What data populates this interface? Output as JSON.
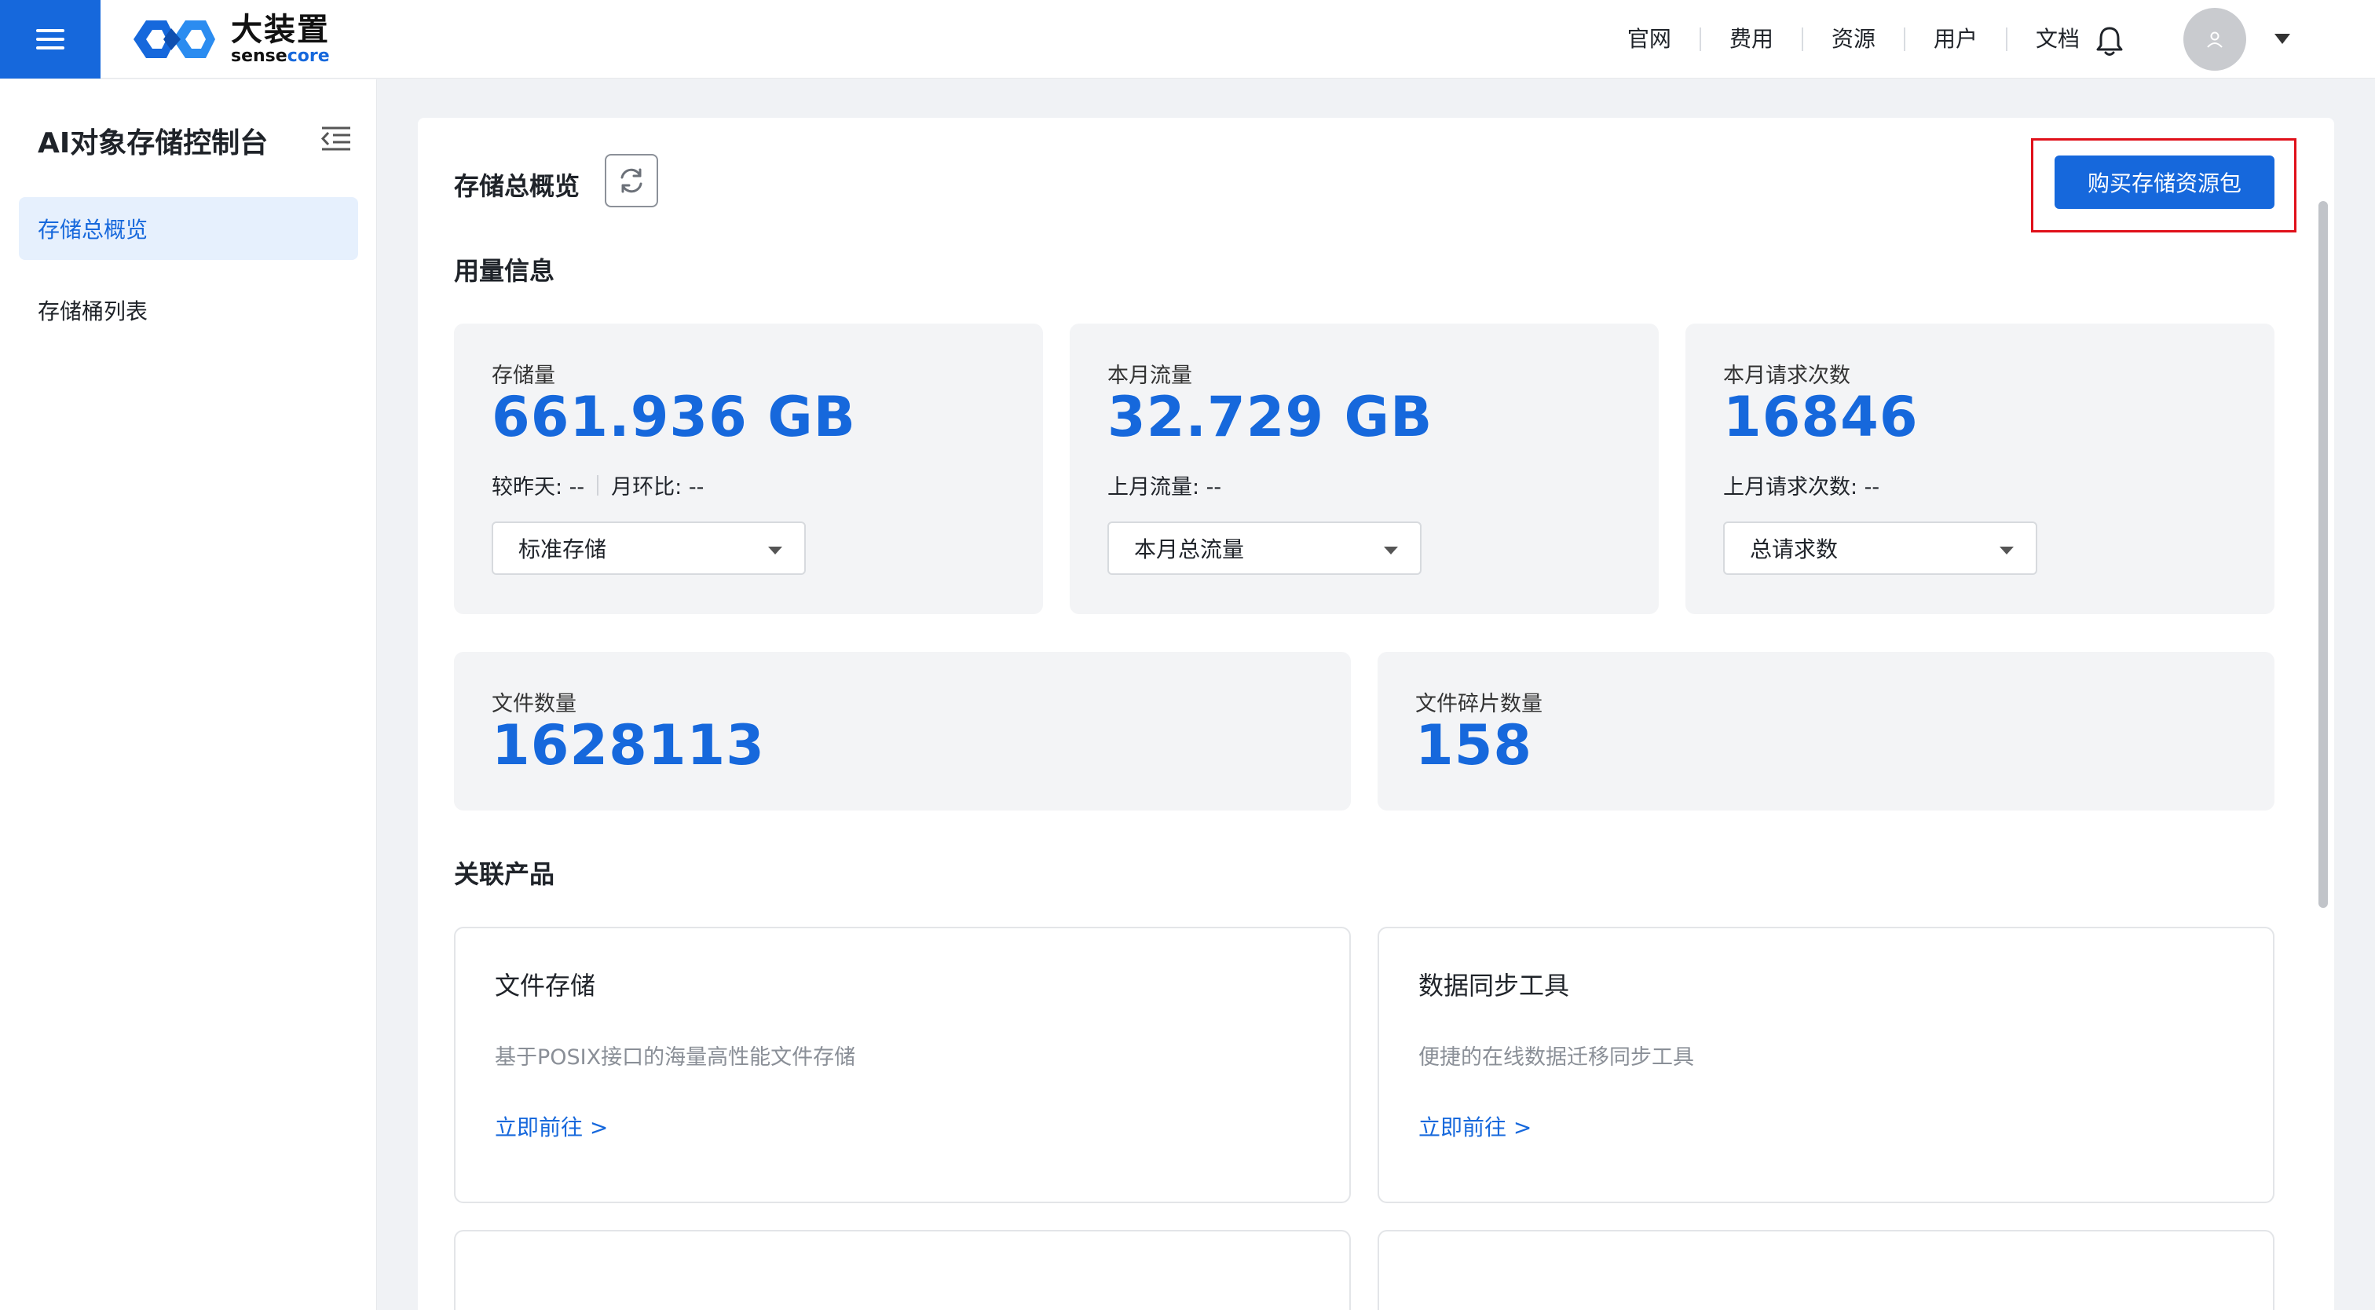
{
  "header": {
    "logo_cn": "大装置",
    "logo_en_a": "sense",
    "logo_en_b": "core",
    "nav": [
      "官网",
      "费用",
      "资源",
      "用户",
      "文档"
    ]
  },
  "sidebar": {
    "title": "AI对象存储控制台",
    "items": [
      {
        "label": "存储总概览",
        "active": true
      },
      {
        "label": "存储桶列表",
        "active": false
      }
    ]
  },
  "main": {
    "title": "存储总概览",
    "buy_button": "购买存储资源包",
    "usage_heading": "用量信息",
    "stats": [
      {
        "label": "存储量",
        "value": "661.936 GB",
        "compare_a": "较昨天: --",
        "compare_b": "月环比: --",
        "select": "标准存储"
      },
      {
        "label": "本月流量",
        "value": "32.729 GB",
        "compare_a": "上月流量: --",
        "select": "本月总流量"
      },
      {
        "label": "本月请求次数",
        "value": "16846",
        "compare_a": "上月请求次数: --",
        "select": "总请求数"
      }
    ],
    "counts": [
      {
        "label": "文件数量",
        "value": "1628113"
      },
      {
        "label": "文件碎片数量",
        "value": "158"
      }
    ],
    "related_heading": "关联产品",
    "products": [
      {
        "title": "文件存储",
        "desc": "基于POSIX接口的海量高性能文件存储",
        "link": "立即前往 >"
      },
      {
        "title": "数据同步工具",
        "desc": "便捷的在线数据迁移同步工具",
        "link": "立即前往 >"
      }
    ]
  },
  "colors": {
    "accent": "#1668dc",
    "highlight_border": "#e0101a"
  },
  "icons": [
    "menu-icon",
    "bell-icon",
    "user-icon",
    "chevron-down-icon",
    "collapse-menu-icon",
    "refresh-icon"
  ]
}
